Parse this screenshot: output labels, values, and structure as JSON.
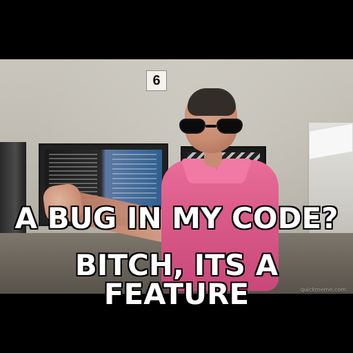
{
  "wall_sign": {
    "text": "6"
  },
  "meme": {
    "top_text": "A BUG IN MY CODE?",
    "bottom_text": "BITCH, ITS A FEATURE"
  },
  "watermark": {
    "text": "quickmeme.com"
  },
  "icons": {
    "sunglasses": "sunglasses-icon"
  },
  "colors": {
    "shirt": "#d95a88",
    "background": "#000000",
    "caption": "#ffffff"
  }
}
